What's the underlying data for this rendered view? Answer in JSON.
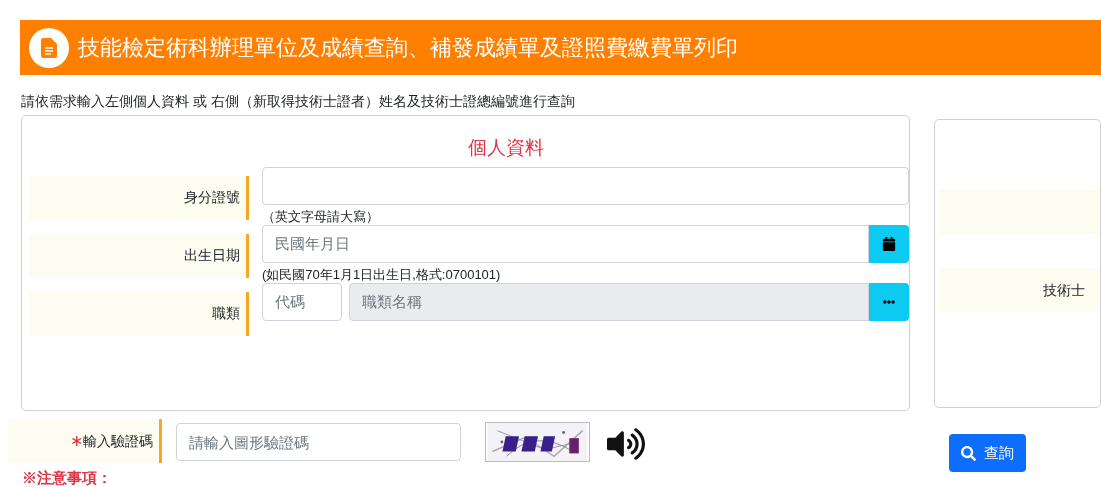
{
  "header": {
    "title": "技能檢定術科辦理單位及成績查詢、補發成績單及證照費繳費單列印"
  },
  "instruction": "請依需求輸入左側個人資料 或 右側（新取得技術士證者）姓名及技術士證總編號進行查詢",
  "left_panel": {
    "title": "個人資料",
    "rows": [
      {
        "kind": "text",
        "label": "身分證號",
        "hint": "（英文字母請大寫）"
      },
      {
        "kind": "date",
        "label": "出生日期",
        "placeholder": "民國年月日",
        "hint": "(如民國70年1月1日出生日,格式:0700101)"
      },
      {
        "kind": "job",
        "label": "職類",
        "code_placeholder": "代碼",
        "name_placeholder": "職類名稱"
      }
    ]
  },
  "right_panel": {
    "rows": [
      {
        "label": ""
      },
      {
        "label": "技術士"
      }
    ]
  },
  "captcha": {
    "required_mark": "∗",
    "label": "輸入驗證碼",
    "placeholder": "請輸入圖形驗證碼"
  },
  "search_button": "查詢",
  "notice_title": "※注意事項："
}
